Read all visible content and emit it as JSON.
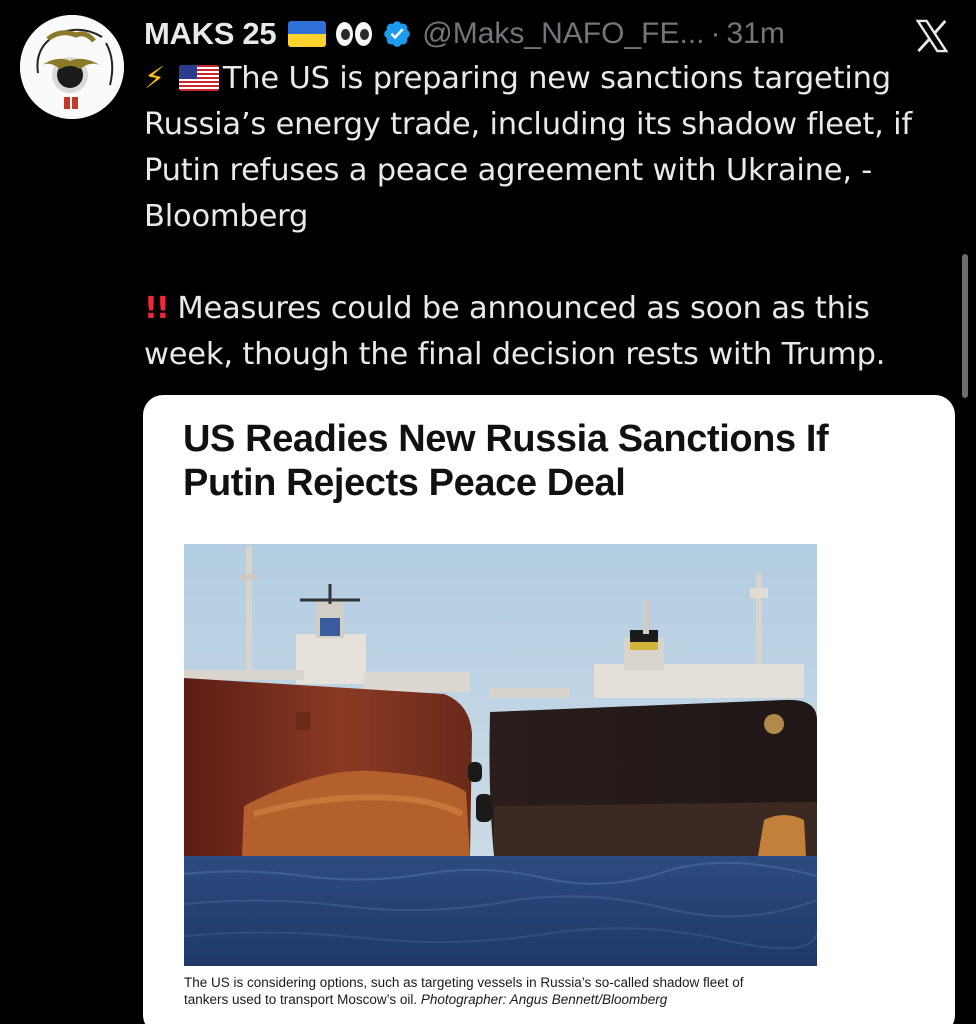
{
  "author": {
    "display_name": "MAKS 25",
    "handle": "@Maks_NAFO_FE...",
    "separator": "·",
    "timestamp": "31m"
  },
  "tweet": {
    "line1": "The US is preparing new sanctions targeting",
    "line2": "Russia’s energy trade, including its shadow fleet, if",
    "line3": "Putin refuses a peace agreement with Ukraine, -",
    "line4": "Bloomberg",
    "bangs": "!!",
    "line5": " Measures could be announced as soon as this",
    "line6": "week, though the final decision rests with Trump."
  },
  "card": {
    "headline_line1": "US Readies New Russia Sanctions If",
    "headline_line2": "Putin Rejects Peace Deal",
    "caption_line1": "The US is considering options, such as targeting vessels in Russia’s so-called shadow fleet of",
    "caption_line2": "tankers used to transport Moscow’s oil.",
    "caption_credit": "Photographer: Angus Bennett/Bloomberg"
  },
  "icons": {
    "avatar": "avatar-image",
    "flag": "ukraine-flag-emoji",
    "eyes": "eyes-emoji",
    "verified": "verified-badge-icon",
    "platform": "x-logo-icon",
    "bolt": "high-voltage-emoji",
    "us_flag": "us-flag-emoji",
    "alert": "double-exclamation-emoji"
  },
  "colors": {
    "background": "#000000",
    "text": "#e7e9ea",
    "muted": "#71767b",
    "verified": "#1d9bf0",
    "alert": "#f0263a"
  }
}
